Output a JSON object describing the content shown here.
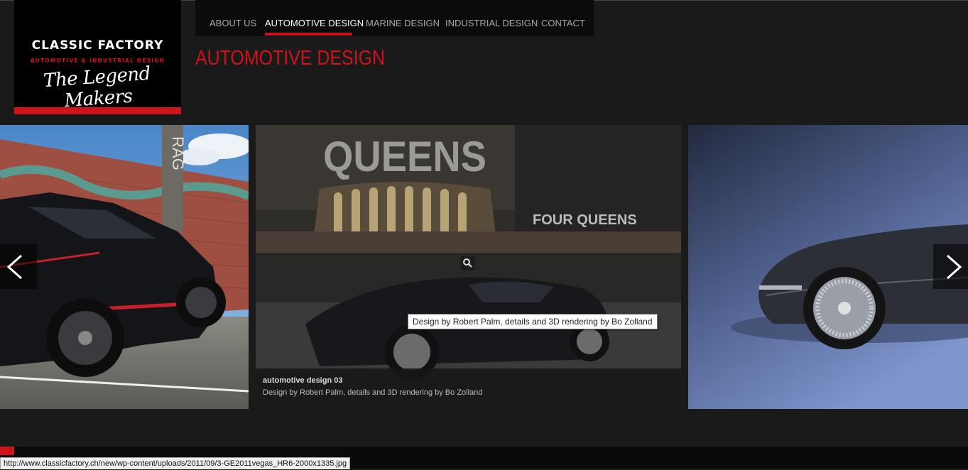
{
  "logo": {
    "name": "CLASSIC FACTORY",
    "tagline": "AUTOMOTIVE & INDUSTRIAL DESIGN",
    "script": "The Legend Makers"
  },
  "nav": {
    "items": [
      {
        "label": "ABOUT US"
      },
      {
        "label": "AUTOMOTIVE DESIGN"
      },
      {
        "label": "MARINE DESIGN"
      },
      {
        "label": "INDUSTRIAL DESIGN"
      },
      {
        "label": "CONTACT"
      }
    ],
    "active": "AUTOMOTIVE DESIGN"
  },
  "page": {
    "title": "AUTOMOTIVE DESIGN"
  },
  "gallery": {
    "caption_title": "automotive design 03",
    "caption_text": "Design by Robert Palm, details and 3D rendering by Bo Zolland",
    "tooltip": "Design by Robert Palm, details and 3D rendering by Bo Zolland",
    "sign_queens": "QUEENS",
    "sign_four_queens": "FOUR QUEENS",
    "wall_sign": "RAG"
  },
  "status_bar": {
    "url": "http://www.classicfactory.ch/new/wp-content/uploads/2011/09/3-GE2011vegas_HR6-2000x1335.jpg"
  },
  "colors": {
    "accent": "#d0121b",
    "background": "#1a1a1a",
    "nav_background": "#0b0b0b"
  }
}
